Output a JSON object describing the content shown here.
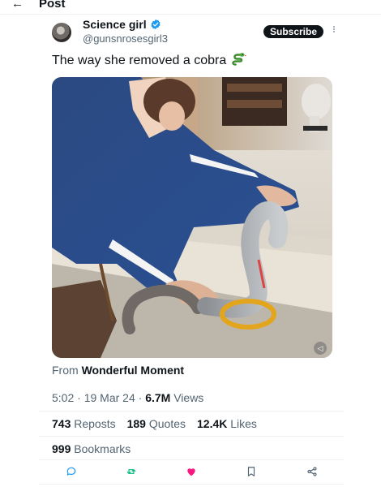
{
  "topbar": {
    "title": "Post",
    "back_icon": "arrow-left-icon"
  },
  "author": {
    "display_name": "Science girl",
    "handle": "@gunsnrosesgirl3",
    "verified_color": "#1d9bf0",
    "subscribe_label": "Subscribe"
  },
  "tweet": {
    "text": "The way she removed a cobra",
    "emoji": "snake"
  },
  "media": {
    "type": "video",
    "mute_icon": "speaker-icon"
  },
  "attribution": {
    "prefix": "From",
    "source": "Wonderful Moment"
  },
  "meta": {
    "time": "5:02",
    "date": "19 Mar 24",
    "views_count": "6.7M",
    "views_label": "Views",
    "separator": " · "
  },
  "stats": {
    "reposts_count": "743",
    "reposts_label": "Reposts",
    "quotes_count": "189",
    "quotes_label": "Quotes",
    "likes_count": "12.4K",
    "likes_label": "Likes",
    "bookmarks_count": "999",
    "bookmarks_label": "Bookmarks"
  },
  "actions": [
    {
      "name": "reply-icon",
      "color": "#1d9bf0"
    },
    {
      "name": "repost-icon",
      "color": "#00ba7c"
    },
    {
      "name": "like-icon",
      "color": "#f91880"
    },
    {
      "name": "bookmark-icon",
      "color": "#536471"
    },
    {
      "name": "share-icon",
      "color": "#536471"
    }
  ]
}
